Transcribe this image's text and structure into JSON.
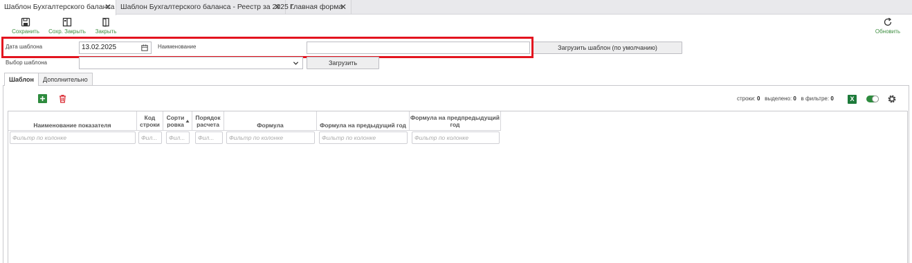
{
  "tabs": [
    {
      "label": "Шаблон Бухгалтерского баланса",
      "close": "✕"
    },
    {
      "label": "Шаблон Бухгалтерского баланса - Реестр за 2025 г.",
      "close": "✕"
    },
    {
      "label": "Главная форма",
      "close": "✕"
    }
  ],
  "toolbar": {
    "save": "Сохранить",
    "save_close": "Сохр. Закрыть",
    "close": "Закрыть",
    "refresh": "Обновить"
  },
  "form": {
    "date_label": "Дата шаблона",
    "date_value": "13.02.2025",
    "name_label": "Наименование",
    "name_value": "",
    "load_default": "Загрузить шаблон (по умолчанию)",
    "choose_label": "Выбор шаблона",
    "choose_value": "",
    "load": "Загрузить"
  },
  "inner_tabs": {
    "template": "Шаблон",
    "extra": "Дополнительно"
  },
  "grid": {
    "stats": {
      "rows_label": "строки:",
      "rows": "0",
      "selected_label": "выделено:",
      "selected": "0",
      "filter_label": "в фильтре:",
      "filter": "0"
    },
    "columns": [
      "Наименование показателя",
      "Код строки",
      "Сорти ровка",
      "Порядок расчета",
      "Формула",
      "Формула на предыдущий год",
      "Формула на предпредыдущий год"
    ],
    "filter_placeholder": "Фильтр по колонке",
    "filter_placeholder_short": "Фил..."
  },
  "colors": {
    "accent_green": "#3e8e41",
    "highlight_red": "#e3141f",
    "excel_green": "#1d7a3a"
  }
}
